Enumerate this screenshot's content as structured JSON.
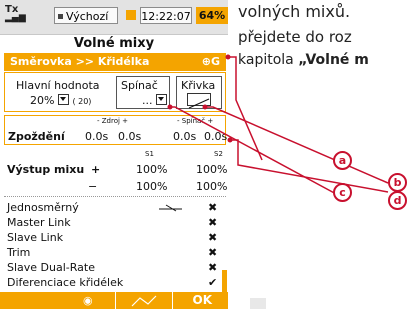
{
  "status": {
    "signal_tx": "Tx",
    "mode": "Výchozí",
    "time": "12:22:07",
    "battery": "64%"
  },
  "title": "Volné mixy",
  "mix_header": {
    "label": "Směrovka >> Křidélka",
    "icon_text": "⊕G"
  },
  "main_value": {
    "label": "Hlavní hodnota",
    "value": "20%",
    "sub": "( 20)"
  },
  "switch": {
    "label": "Spínač",
    "value": "..."
  },
  "curve": {
    "label": "Křivka"
  },
  "delay": {
    "label": "Zpoždění",
    "source_label": "- Zdroj +",
    "switch_label": "- Spínač +",
    "values": [
      "0.0s",
      "0.0s",
      "0.0s",
      "0.0s"
    ]
  },
  "columns": [
    "S1",
    "S2"
  ],
  "output": {
    "label": "Výstup mixu",
    "plus": "+",
    "minus": "−",
    "plus_values": [
      "100%",
      "100%"
    ],
    "minus_values": [
      "100%",
      "100%"
    ]
  },
  "options": [
    {
      "label": "Jednosměrný",
      "value": "✖"
    },
    {
      "label": "Master Link",
      "value": "✖"
    },
    {
      "label": "Slave Link",
      "value": "✖"
    },
    {
      "label": "Trim",
      "value": "✖"
    },
    {
      "label": "Slave Dual-Rate",
      "value": "✖"
    },
    {
      "label": "Diferenciace křidélek",
      "value": "✔"
    }
  ],
  "footer": {
    "ok": "OK"
  },
  "callouts": [
    "a",
    "b",
    "c",
    "d"
  ],
  "doc_text": {
    "line1": "volných mixů.",
    "line2": "přejdete do roz",
    "line3_prefix": "kapitola ",
    "line3_bold": "„Volné m"
  },
  "colors": {
    "accent": "#f4a400",
    "callout": "#c8102e"
  }
}
